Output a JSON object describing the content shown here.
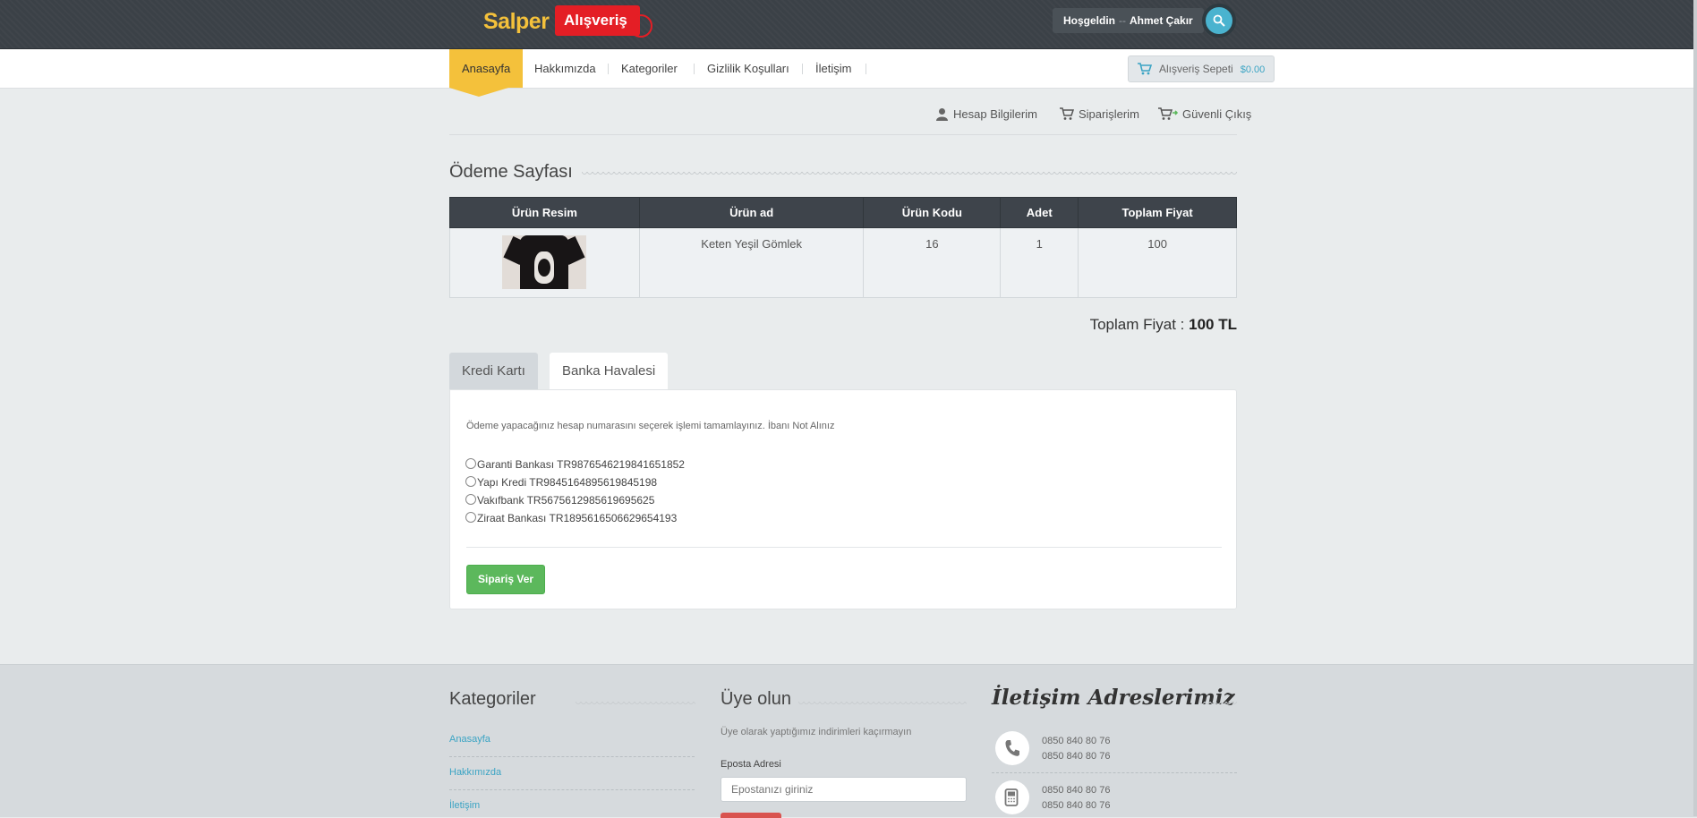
{
  "header": {
    "logo_main": "Salper",
    "logo_tag": "Alışveriş",
    "welcome_prefix": "Hoşgeldin",
    "welcome_sep": "--",
    "user_name": "Ahmet Çakır",
    "search_icon": "search-icon"
  },
  "nav": {
    "items": [
      {
        "label": "Anasayfa",
        "active": true
      },
      {
        "label": "Hakkımızda"
      },
      {
        "label": "Kategoriler"
      },
      {
        "label": "Gizlilik Koşulları"
      },
      {
        "label": "İletişim"
      }
    ],
    "cart_label": "Alışveriş Sepeti",
    "cart_total": "$0.00",
    "cart_icon": "cart-icon"
  },
  "account_links": {
    "profile": "Hesap Bilgilerim",
    "orders": "Siparişlerim",
    "logout": "Güvenli Çıkış"
  },
  "page": {
    "title": "Ödeme Sayfası"
  },
  "table": {
    "headers": [
      "Ürün Resim",
      "Ürün ad",
      "Ürün Kodu",
      "Adet",
      "Toplam Fiyat"
    ],
    "rows": [
      {
        "image": "black t-shirt with white print",
        "name": "Keten Yeşil Gömlek",
        "code": "16",
        "qty": "1",
        "total": "100"
      }
    ]
  },
  "summary": {
    "label": "Toplam Fiyat :",
    "value": "100 TL"
  },
  "payment": {
    "tabs": [
      "Kredi Kartı",
      "Banka Havalesi"
    ],
    "active_tab": "Banka Havalesi",
    "info": "Ödeme yapacağınız hesap numarasını seçerek işlemi tamamlayınız. İbanı Not Alınız",
    "banks": [
      "Garanti Bankası TR9876546219841651852",
      "Yapı Kredi TR9845164895619845198",
      "Vakıfbank TR5675612985619695625",
      "Ziraat Bankası TR1895616506629654193"
    ],
    "submit_label": "Sipariş Ver"
  },
  "footer": {
    "categories_title": "Kategoriler",
    "category_links": [
      "Anasayfa",
      "Hakkımızda",
      "İletişim"
    ],
    "subscribe_title": "Üye olun",
    "subscribe_text": "Üye olarak yaptığımız indirimleri kaçırmayın",
    "email_label": "Eposta Adresi",
    "email_placeholder": "Epostanızı giriniz",
    "contact_title": "İletişim Adreslerimiz",
    "phone_numbers": [
      "0850 840 80 76",
      "0850 840 80 76"
    ],
    "mobile_numbers": [
      "0850 840 80 76",
      "0850 840 80 76"
    ]
  },
  "colors": {
    "topbar": "#3b4147",
    "accent_yellow": "#f4c13b",
    "accent_blue": "#3ba4c4",
    "brand_red": "#e41e25",
    "success": "#5cb85c",
    "table_header": "#3e444b"
  }
}
